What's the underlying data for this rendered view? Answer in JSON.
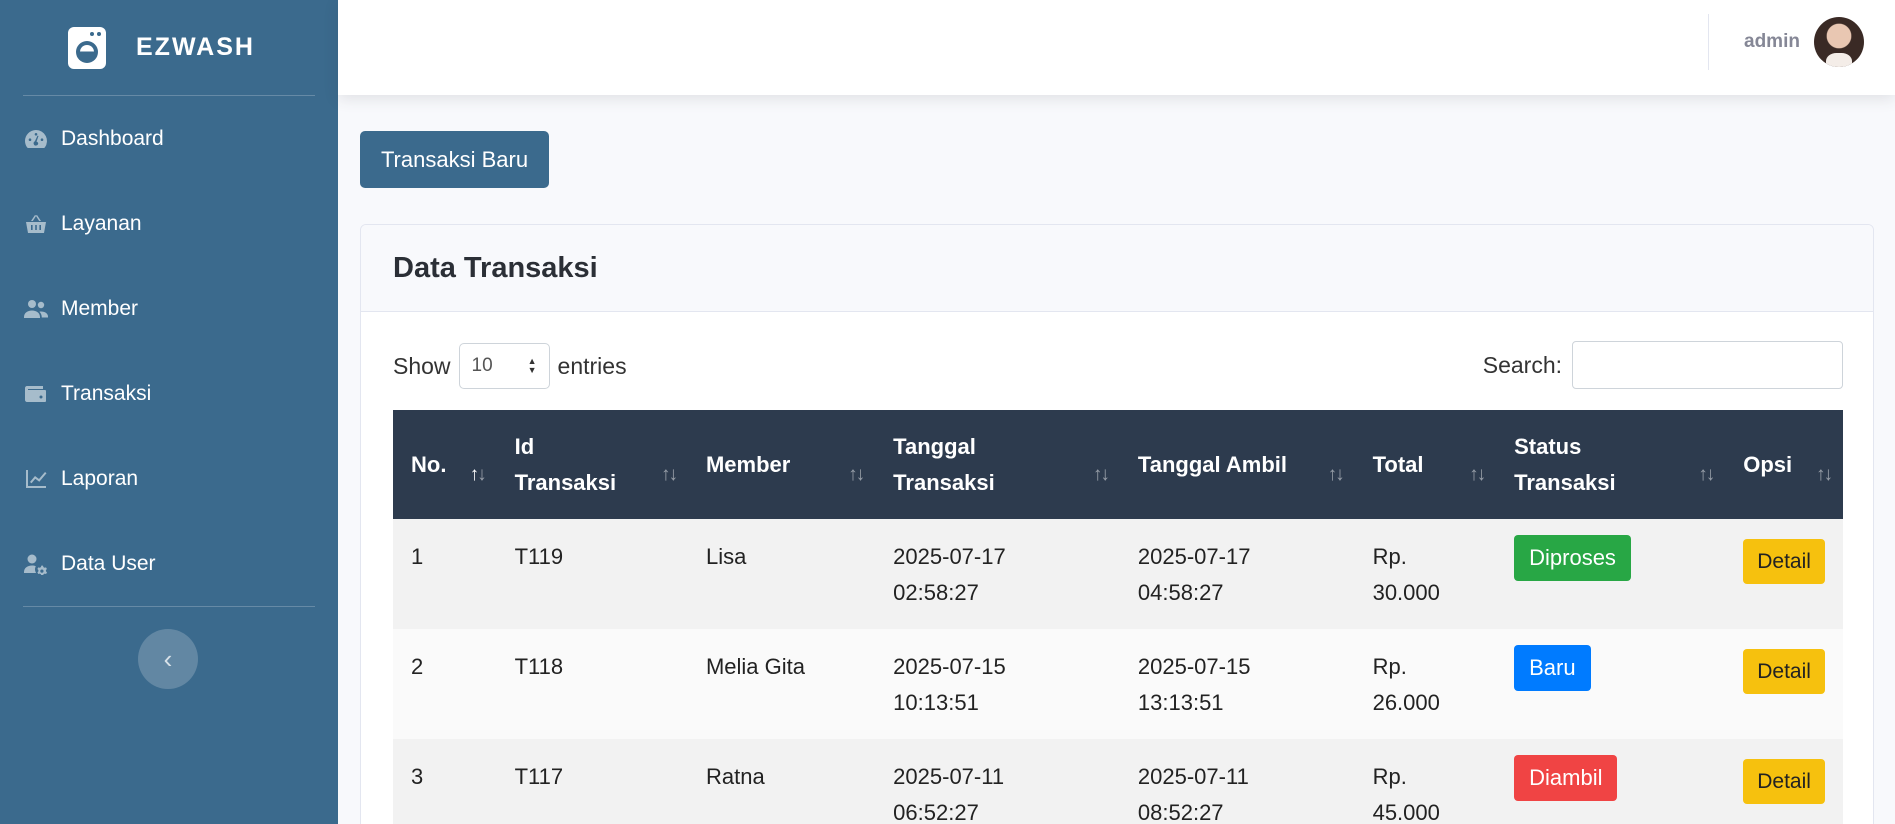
{
  "brand": {
    "name": "EZWASH",
    "icon": "washing-machine-icon"
  },
  "sidebar": {
    "items": [
      {
        "label": "Dashboard",
        "icon": "gauge-icon"
      },
      {
        "label": "Layanan",
        "icon": "basket-icon"
      },
      {
        "label": "Member",
        "icon": "users-icon"
      },
      {
        "label": "Transaksi",
        "icon": "wallet-icon"
      },
      {
        "label": "Laporan",
        "icon": "chart-line-icon"
      },
      {
        "label": "Data User",
        "icon": "user-gear-icon"
      }
    ],
    "toggle_icon": "chevron-left-icon"
  },
  "topbar": {
    "user_name": "admin"
  },
  "actions": {
    "new_transaction": "Transaksi Baru"
  },
  "card": {
    "title": "Data Transaksi",
    "show_label": "Show",
    "entries_value": "10",
    "entries_label": "entries",
    "search_label": "Search:",
    "search_value": ""
  },
  "table": {
    "columns": {
      "no": "No.",
      "id_line1": "Id",
      "id_line2": "Transaksi",
      "member": "Member",
      "tgl_line1": "Tanggal",
      "tgl_line2": "Transaksi",
      "ambil": "Tanggal Ambil",
      "total": "Total",
      "status_line1": "Status",
      "status_line2": "Transaksi",
      "opsi": "Opsi"
    },
    "rows": [
      {
        "no": "1",
        "id": "T119",
        "member": "Lisa",
        "tgl_date": "2025-07-17",
        "tgl_time": "02:58:27",
        "ambil_date": "2025-07-17",
        "ambil_time": "04:58:27",
        "total_cur": "Rp.",
        "total_amt": "30.000",
        "status": "Diproses",
        "action": "Detail"
      },
      {
        "no": "2",
        "id": "T118",
        "member": "Melia Gita",
        "tgl_date": "2025-07-15",
        "tgl_time": "10:13:51",
        "ambil_date": "2025-07-15",
        "ambil_time": "13:13:51",
        "total_cur": "Rp.",
        "total_amt": "26.000",
        "status": "Baru",
        "action": "Detail"
      },
      {
        "no": "3",
        "id": "T117",
        "member": "Ratna",
        "tgl_date": "2025-07-11",
        "tgl_time": "06:52:27",
        "ambil_date": "2025-07-11",
        "ambil_time": "08:52:27",
        "total_cur": "Rp.",
        "total_amt": "45.000",
        "status": "Diambil",
        "action": "Detail"
      }
    ]
  },
  "colors": {
    "sidebar_bg": "#3b6a8d",
    "table_header_bg": "#2d3b4e",
    "status_diproses": "#28a745",
    "status_baru": "#007bff",
    "status_diambil": "#f04444",
    "detail_button": "#f6c10e"
  }
}
